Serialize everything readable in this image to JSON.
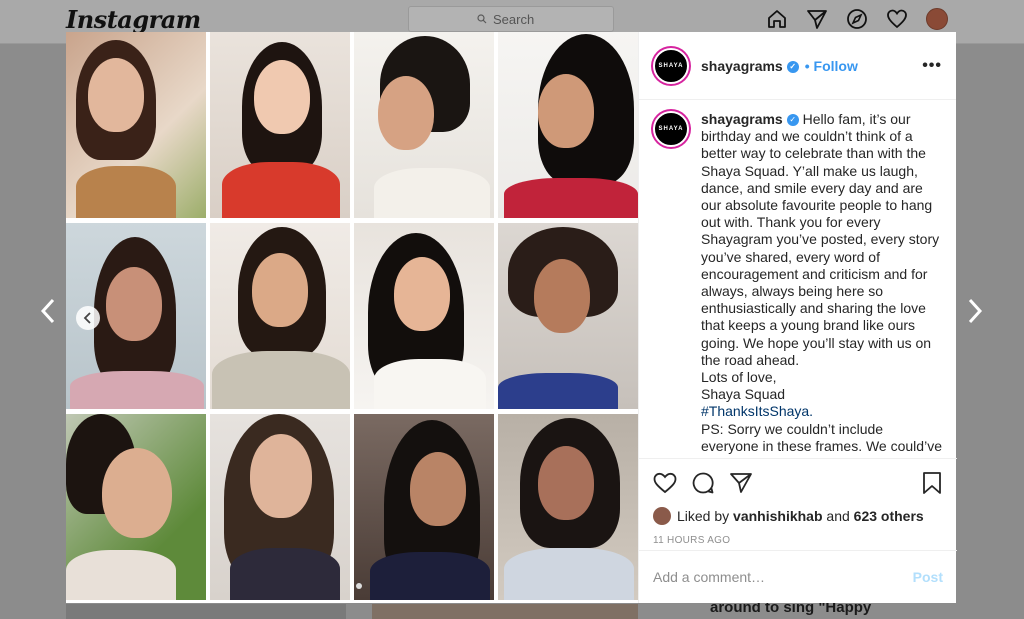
{
  "header": {
    "logo": "Instagram",
    "search_placeholder": "Search",
    "icons": [
      "home-icon",
      "direct-icon",
      "explore-icon",
      "activity-heart-icon",
      "profile-avatar"
    ]
  },
  "post": {
    "username": "shayagrams",
    "follow_label": "Follow",
    "more_label": "•••",
    "avatar_text": "SHAYA",
    "caption": {
      "username": "shayagrams",
      "body": "Hello fam, it’s our birthday and we couldn’t think of a better way to celebrate than with the Shaya Squad. Y’all make us laugh, dance, and smile every day and are our absolute favourite people to hang out with. Thank you for every Shayagram you’ve posted, every story you’ve shared, every word of encouragement and criticism and for always, always being here so enthusiastically and sharing the love that keeps a young brand like ours going. We hope you’ll stay with us on the road ahead.",
      "signoff_1": "Lots of love,",
      "signoff_2": "Shaya Squad",
      "hashtag": "#ThanksItsShaya.",
      "ps": "PS: Sorry we couldn’t include everyone in these frames. We could’ve tried harder but made this at the last min😅"
    },
    "liked_by_prefix": "Liked by",
    "liked_by_user": "vanhishikhab",
    "liked_by_and": "and",
    "liked_by_others": "623 others",
    "timestamp": "11 HOURS AGO",
    "comment_placeholder": "Add a comment…",
    "post_label": "Post"
  },
  "background": {
    "caption_fragment": "around to sing \"Happy"
  },
  "colors": {
    "accent_blue": "#3897f0",
    "post_disabled": "#b2dffc",
    "hashtag": "#003569"
  }
}
